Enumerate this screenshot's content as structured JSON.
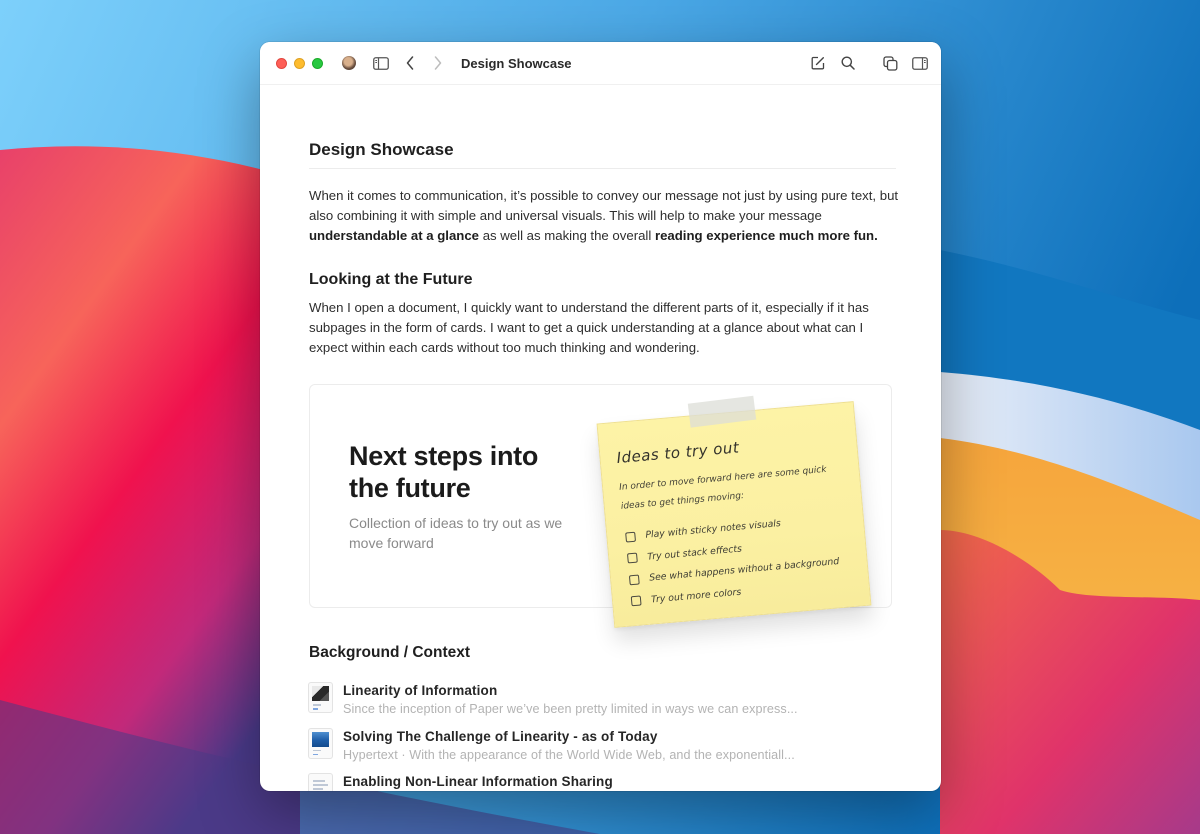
{
  "window": {
    "title": "Design Showcase",
    "traffic_lights": [
      "close",
      "minimize",
      "maximize"
    ],
    "toolbar_left": [
      {
        "name": "avatar",
        "icon": "user-avatar"
      },
      {
        "name": "sidebar-toggle",
        "icon": "sidebar-icon"
      },
      {
        "name": "back",
        "icon": "chevron-left-icon"
      },
      {
        "name": "forward",
        "icon": "chevron-right-icon"
      }
    ],
    "toolbar_right": [
      {
        "name": "compose",
        "icon": "compose-icon"
      },
      {
        "name": "search",
        "icon": "search-icon"
      },
      {
        "name": "duplicate",
        "icon": "copy-icon"
      },
      {
        "name": "inspector",
        "icon": "right-panel-icon"
      }
    ]
  },
  "document": {
    "title": "Design Showcase",
    "intro": {
      "part1": "When it comes to communication, it’s possible to convey our message not just by using pure text, but also combining it with simple and universal visuals. This will help to make your message ",
      "bold1": "understandable at a glance",
      "part2": " as well as making the overall ",
      "bold2": "reading experience much more fun."
    },
    "section1": {
      "heading": "Looking at the Future",
      "body": "When I open a document, I quickly want to understand the different parts of it, especially if it has subpages in the form of cards. I want to get a quick understanding at a glance about what can I expect within each cards without too much thinking and wondering."
    },
    "card": {
      "title": "Next steps into the future",
      "subtitle": "Collection of ideas to try out as we move forward"
    },
    "sticky_note": {
      "title": "Ideas to try out",
      "intro": "In order to move forward here are some quick ideas to get things moving:",
      "items": [
        {
          "label": "Play with sticky notes visuals",
          "checked": false
        },
        {
          "label": "Try out stack effects",
          "checked": false
        },
        {
          "label": "See what happens without a background",
          "checked": false
        },
        {
          "label": "Try out more colors",
          "checked": false
        }
      ]
    },
    "section2": {
      "heading": "Background / Context",
      "references": [
        {
          "title": "Linearity of Information",
          "description": "Since the inception of Paper we’ve been pretty limited in ways we can express..."
        },
        {
          "title": "Solving The Challenge of Linearity - as of Today",
          "description": "Hypertext · With the appearance of the World Wide Web, and the exponentiall..."
        },
        {
          "title": "Enabling Non-Linear Information Sharing",
          "description": ""
        }
      ]
    }
  },
  "colors": {
    "traffic_close": "#fe5f57",
    "traffic_min": "#febc2e",
    "traffic_max": "#28c840",
    "sticky_note": "#fbf0a2",
    "text_primary": "#1f1f1f",
    "text_muted": "#b3b3b3"
  }
}
